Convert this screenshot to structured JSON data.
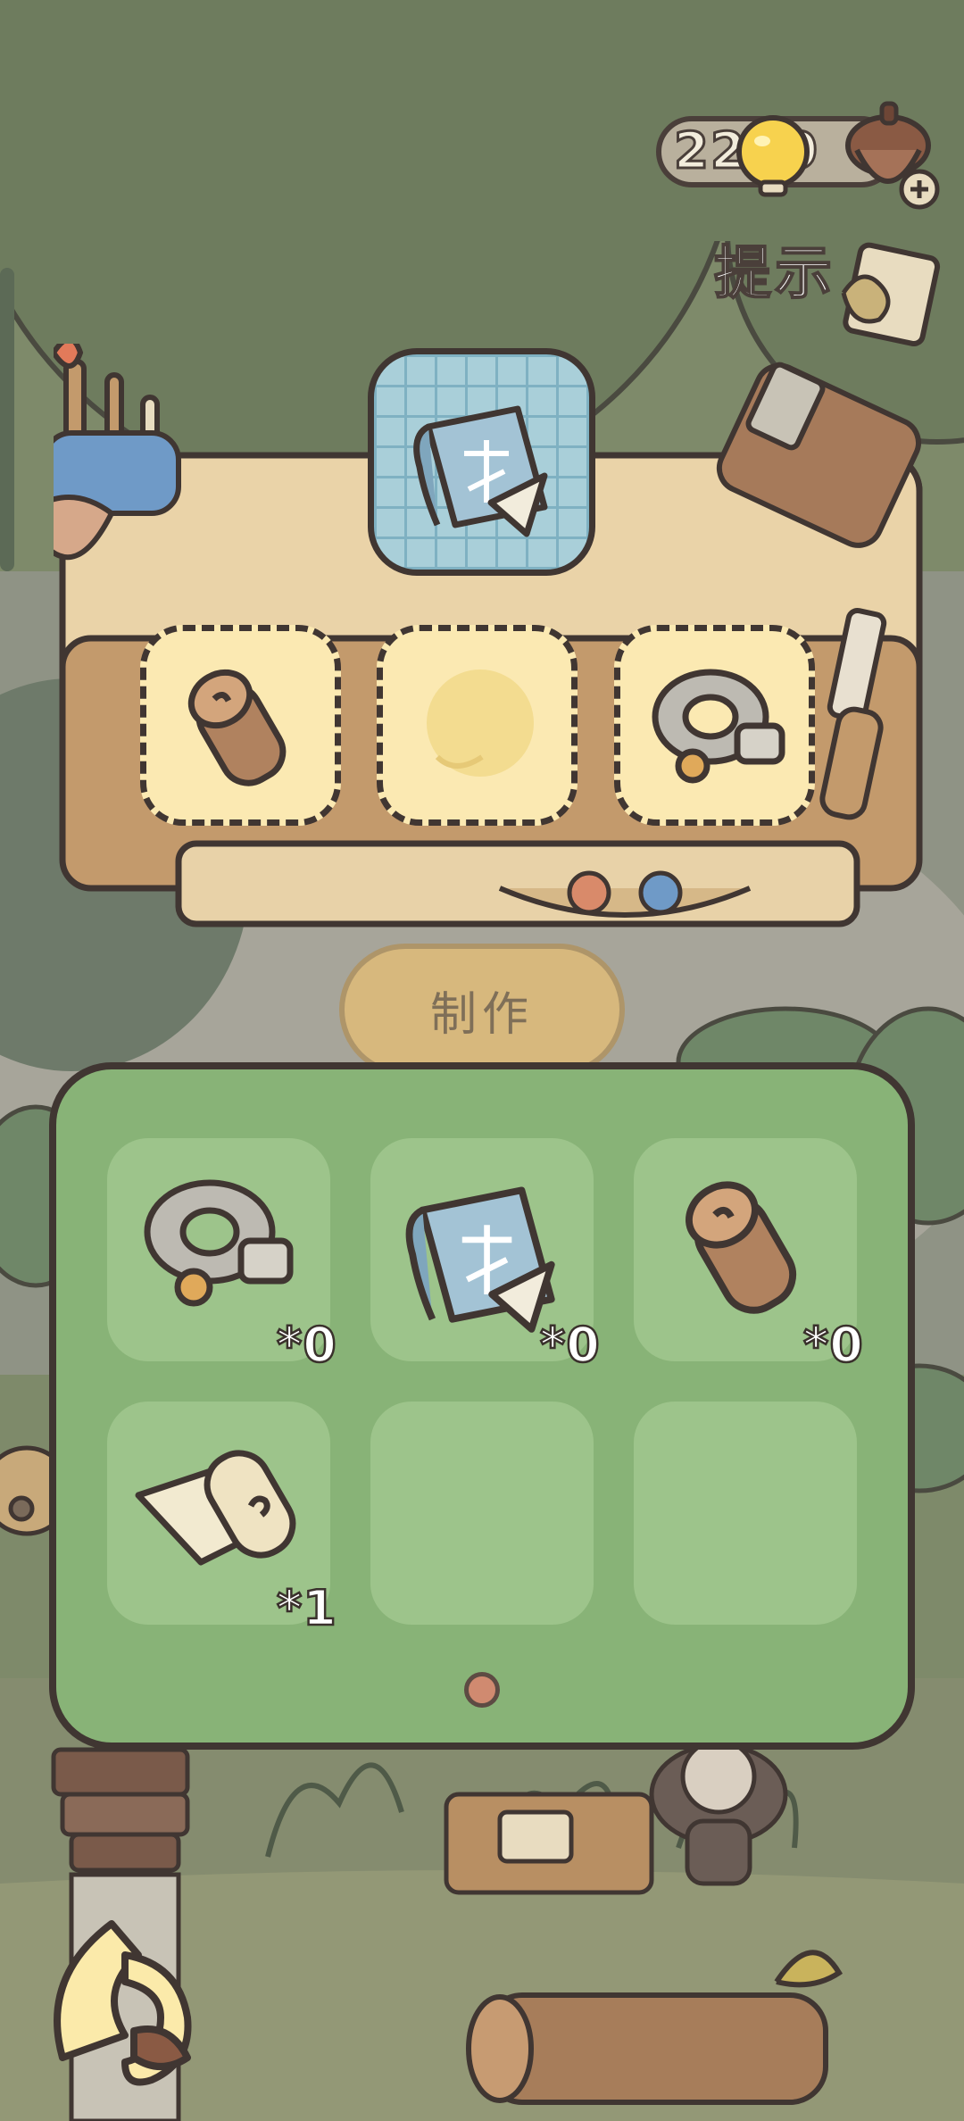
{
  "hud": {
    "counter_value": "2299",
    "hint_label": "提示"
  },
  "workbench": {
    "target_item": "blueprint",
    "slots": [
      {
        "item": "log",
        "filled": true
      },
      {
        "item": "cloth-roll",
        "filled": false
      },
      {
        "item": "gear-parts",
        "filled": true
      }
    ]
  },
  "craft_button": {
    "label": "制作",
    "enabled": false
  },
  "inventory": {
    "items": [
      {
        "item": "gear-parts",
        "count": "*0"
      },
      {
        "item": "blueprint",
        "count": "*0"
      },
      {
        "item": "log",
        "count": "*0"
      },
      {
        "item": "cloth-roll",
        "count": "*1"
      }
    ],
    "page_count": 1,
    "current_page": 1
  },
  "colors": {
    "panel": "#88b377",
    "slot": "#fbe9b2",
    "outline": "#403632",
    "craft_button": "#e2bc76"
  }
}
